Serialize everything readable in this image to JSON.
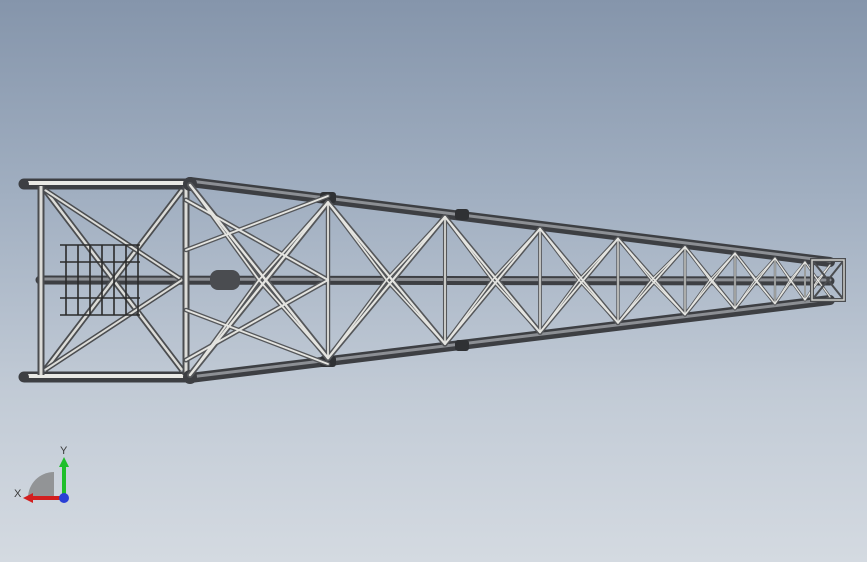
{
  "viewport": {
    "model_name": "boom-truss-section",
    "background_top": "#8595ab",
    "background_bottom": "#d4dae1"
  },
  "triad": {
    "x_label": "X",
    "y_label": "Y",
    "x_color": "#d21e1e",
    "y_color": "#1fbf2a",
    "z_color": "#2a3fd6"
  },
  "colors": {
    "chord": "#5d5f63",
    "chord_highlight": "#9a9da2",
    "member": "#d8d9d5",
    "member_shade": "#7d7f7c",
    "ladder": "#2b2b2b"
  }
}
